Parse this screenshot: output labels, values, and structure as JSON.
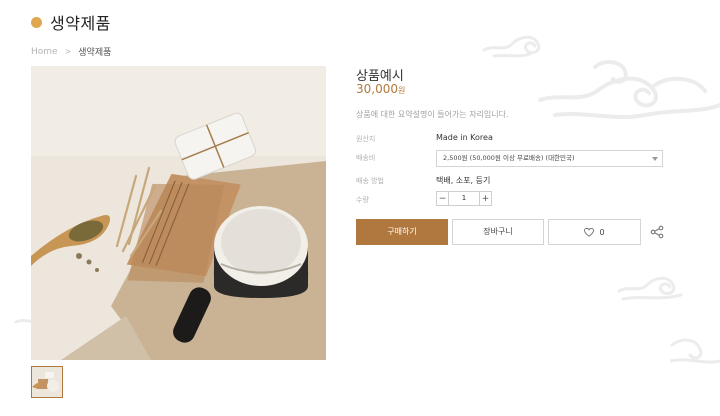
{
  "page": {
    "title": "생약제품"
  },
  "breadcrumb": {
    "home": "Home",
    "separator": ">",
    "current": "생약제품"
  },
  "product": {
    "name": "상품예시",
    "price": "30,000",
    "price_unit": "원",
    "description": "상품에 대한 요약설명이 들어가는 자리입니다.",
    "origin_label": "원산지",
    "origin_value": "Made in Korea",
    "shipping_fee_label": "배송비",
    "shipping_fee_selected": "2,500원 (50,000원 이상 무료배송) (대한민국)",
    "shipping_method_label": "배송 방법",
    "shipping_method_value": "택배, 소포, 등기",
    "quantity_label": "수량",
    "quantity_value": "1",
    "qty_minus": "−",
    "qty_plus": "+"
  },
  "actions": {
    "buy": "구매하기",
    "cart": "장바구니",
    "wish_count": "0"
  },
  "icons": {
    "title_dot": "circle-dot-icon",
    "wish": "heart-icon",
    "share": "share-icon",
    "select_caret": "chevron-down-icon"
  },
  "colors": {
    "accent": "#b0783e",
    "dot": "#e0a650",
    "deco": "#eeeeee"
  }
}
